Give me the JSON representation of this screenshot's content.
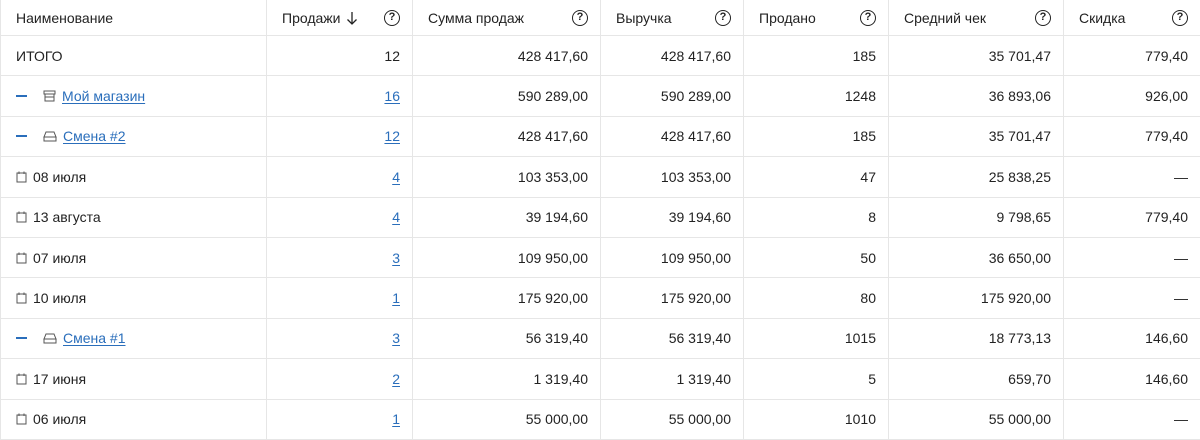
{
  "columns": [
    {
      "label": "Наименование",
      "help": false,
      "sort": false
    },
    {
      "label": "Продажи",
      "help": true,
      "sort": true
    },
    {
      "label": "Сумма продаж",
      "help": true,
      "sort": false
    },
    {
      "label": "Выручка",
      "help": true,
      "sort": false
    },
    {
      "label": "Продано",
      "help": true,
      "sort": false
    },
    {
      "label": "Средний чек",
      "help": true,
      "sort": false
    },
    {
      "label": "Скидка",
      "help": true,
      "sort": false
    }
  ],
  "help_glyph": "?",
  "rows": [
    {
      "type": "total",
      "name": "ИТОГО",
      "sales": "12",
      "sum": "428 417,60",
      "revenue": "428 417,60",
      "sold": "185",
      "avg": "35 701,47",
      "discount": "779,40"
    },
    {
      "type": "store",
      "name": "Мой магазин",
      "sales": "16",
      "sum": "590 289,00",
      "revenue": "590 289,00",
      "sold": "1248",
      "avg": "36 893,06",
      "discount": "926,00"
    },
    {
      "type": "shift",
      "name": "Смена #2",
      "sales": "12",
      "sum": "428 417,60",
      "revenue": "428 417,60",
      "sold": "185",
      "avg": "35 701,47",
      "discount": "779,40"
    },
    {
      "type": "day",
      "name": "08 июля",
      "sales": "4",
      "sum": "103 353,00",
      "revenue": "103 353,00",
      "sold": "47",
      "avg": "25 838,25",
      "discount": "—"
    },
    {
      "type": "day",
      "name": "13 августа",
      "sales": "4",
      "sum": "39 194,60",
      "revenue": "39 194,60",
      "sold": "8",
      "avg": "9 798,65",
      "discount": "779,40"
    },
    {
      "type": "day",
      "name": "07 июля",
      "sales": "3",
      "sum": "109 950,00",
      "revenue": "109 950,00",
      "sold": "50",
      "avg": "36 650,00",
      "discount": "—"
    },
    {
      "type": "day",
      "name": "10 июля",
      "sales": "1",
      "sum": "175 920,00",
      "revenue": "175 920,00",
      "sold": "80",
      "avg": "175 920,00",
      "discount": "—"
    },
    {
      "type": "shift",
      "name": "Смена #1",
      "sales": "3",
      "sum": "56 319,40",
      "revenue": "56 319,40",
      "sold": "1015",
      "avg": "18 773,13",
      "discount": "146,60"
    },
    {
      "type": "day",
      "name": "17 июня",
      "sales": "2",
      "sum": "1 319,40",
      "revenue": "1 319,40",
      "sold": "5",
      "avg": "659,70",
      "discount": "146,60"
    },
    {
      "type": "day",
      "name": "06 июля",
      "sales": "1",
      "sum": "55 000,00",
      "revenue": "55 000,00",
      "sold": "1010",
      "avg": "55 000,00",
      "discount": "—"
    }
  ],
  "colors": {
    "link": "#2a6ebb",
    "border": "#e6e6e6",
    "text": "#222222"
  }
}
